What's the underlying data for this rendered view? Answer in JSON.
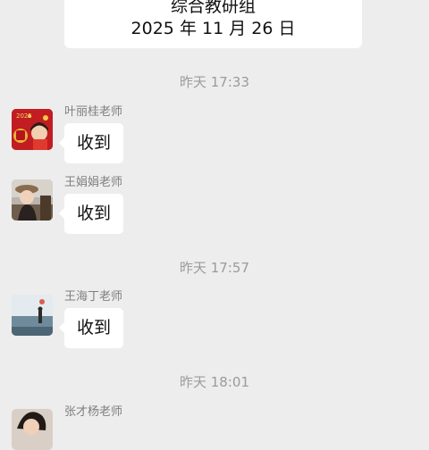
{
  "header_card": {
    "line1": "综合教研组",
    "line2": "2025 年 11 月 26 日"
  },
  "timestamps": [
    "昨天 17:33",
    "昨天 17:57",
    "昨天 18:01"
  ],
  "messages": [
    {
      "sender": "叶丽桂老师",
      "text": "收到",
      "avatar_label": "2025"
    },
    {
      "sender": "王娟娟老师",
      "text": "收到"
    },
    {
      "sender": "王海丁老师",
      "text": "收到"
    },
    {
      "sender": "张才杨老师"
    }
  ],
  "colors": {
    "background": "#ededed",
    "bubble": "#ffffff",
    "timestamp_text": "#9b9b9b",
    "sender_text": "#7f7f7f"
  }
}
